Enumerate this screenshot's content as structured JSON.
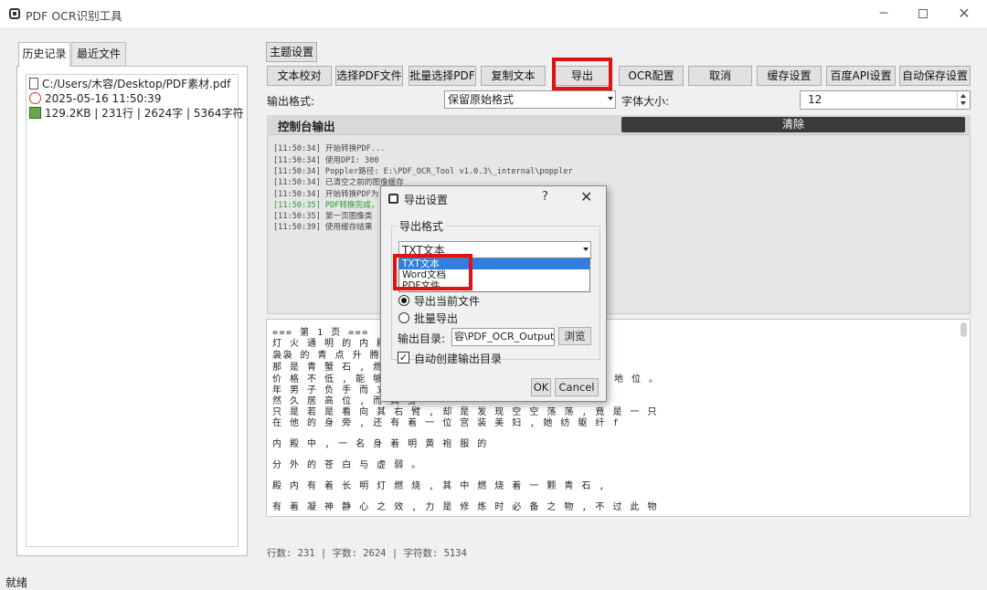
{
  "window": {
    "title": "PDF OCR识别工具",
    "minimize": "─",
    "close": "✕"
  },
  "left_tabs": [
    "历史记录",
    "最近文件"
  ],
  "history": {
    "path": "C:/Users/木容/Desktop/PDF素材.pdf",
    "time": "2025-05-16 11:50:39",
    "stats": "129.2KB | 231行 | 2624字 | 5364字符"
  },
  "theme_button": "主题设置",
  "toolbar": [
    "文本校对",
    "选择PDF文件",
    "批量选择PDF",
    "复制文本",
    "导出",
    "OCR配置",
    "取消",
    "缓存设置",
    "百度API设置",
    "自动保存设置"
  ],
  "format_row": {
    "label": "输出格式:",
    "value": "保留原始格式",
    "font_label": "字体大小:",
    "font_size": "12"
  },
  "console": {
    "title": "控制台输出",
    "clear": "清除",
    "lines": [
      "[11:50:34] 开始转换PDF...",
      "[11:50:34] 使用DPI: 300",
      "[11:50:34] Poppler路径: E:\\PDF_OCR_Tool v1.0.3\\_internal\\poppler",
      "[11:50:34] 已清空之前的图像缓存",
      "[11:50:34] 开始转换PDF为",
      "[11:50:35] PDF转换完成,",
      "[11:50:35] 第一页图像类",
      "[11:50:39] 使用缓存结果"
    ]
  },
  "output": {
    "lines": [
      "=== 第 1 页 ===",
      "灯 火 通 明 的 内 殿 之",
      "袅袅 的 青 点 升 腾 而 起",
      "那 是 青 蟹 石 , 燃 烧 着",
      "价 格 不 低 , 能 够 当 做",
      "年 男 子 负 手 而 立 , 仿",
      "然 久 居 高 位 , 而 其 身",
      "只 是 若 是 看 向 其 右 臂 , 却 是 发 现 空 空 荡 荡 , 竟 是 一 只",
      "在 他 的 身 旁 , 还 有 着 一 位 宫 装 美 妇 , 她 纺 躯 纤 f",
      "内 殿 中 , 一 名 身 着 明 黄 袍 服 的",
      "分 外 的 苍 白 与 虚 弱 。",
      "殿 内 有 着 长 明 灯 燃 烧 , 其 中 燃 烧 着 一 颗 青 石 ,",
      "有 着 凝 神 静 心 之 效 , 力 是 修 炼 时 必 备 之 物 , 不 过 此 物"
    ],
    "right_fragment": "地 位 。"
  },
  "stats_bar": "行数: 231  |  字数: 2624  |  字符数: 5134",
  "status": "就绪",
  "dialog": {
    "title": "导出设置",
    "help": "?",
    "close": "✕",
    "group_label": "导出格式",
    "format_value": "TXT文本",
    "options": [
      "TXT文本",
      "Word文档",
      "PDF文件"
    ],
    "radio_current": "导出当前文件",
    "radio_batch": "批量导出",
    "dir_label": "输出目录:",
    "dir_value": "容\\PDF_OCR_Output",
    "browse": "浏览",
    "auto_create": "自动创建输出目录",
    "ok": "OK",
    "cancel": "Cancel"
  },
  "accent": {
    "highlight_red": "#e21212",
    "selection_blue": "#2f7fe0",
    "log_green": "#2a9a2a"
  }
}
